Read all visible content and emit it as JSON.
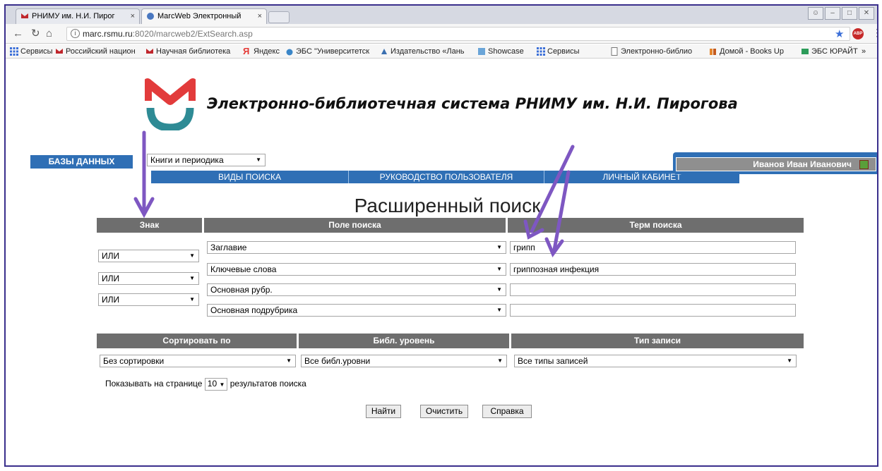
{
  "browser": {
    "tabs": [
      {
        "title": "РНИМУ им. Н.И. Пирог",
        "close": "×"
      },
      {
        "title": "MarcWeb Электронный",
        "close": "×"
      }
    ],
    "url_host": "marc.rsmu.ru",
    "url_rest": ":8020/marcweb2/ExtSearch.asp",
    "bookmarks": [
      "Сервисы",
      "Российский национ",
      "Научная библиотека",
      "Яндекс",
      "ЭБС \"Университетск",
      "Издательство «Лань",
      "Showcase",
      "Сервисы",
      "Электронно-библио",
      "Домой - Books Up",
      "ЭБС ЮРАЙТ",
      "»"
    ]
  },
  "site": {
    "title": "Электронно-библиотечная система РНИМУ им. Н.И. Пирогова",
    "databases_label": "БАЗЫ ДАННЫХ",
    "database_selected": "Книги и периодика",
    "nav": [
      "ВИДЫ ПОИСКА",
      "РУКОВОДСТВО ПОЛЬЗОВАТЕЛЯ",
      "ЛИЧНЫЙ КАБИНЕТ"
    ],
    "user_name": "Иванов Иван Иванович"
  },
  "search": {
    "title": "Расширенный поиск",
    "headers": {
      "operator": "Знак",
      "field": "Поле поиска",
      "term": "Терм поиска"
    },
    "rows": [
      {
        "field": "Заглавие",
        "term": "грипп"
      },
      {
        "operator": "ИЛИ",
        "field": "Ключевые слова",
        "term": "гриппозная инфекция"
      },
      {
        "operator": "ИЛИ",
        "field": "Основная рубр.",
        "term": ""
      },
      {
        "operator": "ИЛИ",
        "field": "Основная подрубрика",
        "term": ""
      }
    ],
    "options_headers": {
      "sort": "Сортировать по",
      "level": "Библ. уровень",
      "type": "Тип записи"
    },
    "options_values": {
      "sort": "Без сортировки",
      "level": "Все библ.уровни",
      "type": "Все типы записей"
    },
    "per_page_before": "Показывать на странице",
    "per_page_value": "10",
    "per_page_after": "результатов поиска",
    "buttons": {
      "find": "Найти",
      "clear": "Очистить",
      "help": "Справка"
    }
  },
  "colors": {
    "nav_blue": "#2f6fb5",
    "header_gray": "#6e6e6e",
    "arrow": "#7e57c2"
  }
}
